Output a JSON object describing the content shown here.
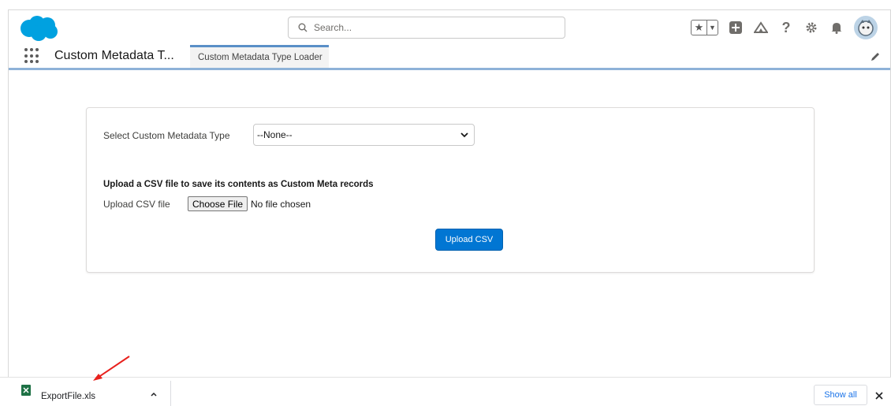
{
  "header": {
    "search_placeholder": "Search...",
    "icons": [
      "salesforce-cloud-logo",
      "star-icon",
      "chevron-down-icon",
      "plus-icon",
      "trailhead-icon",
      "help-icon",
      "gear-icon",
      "bell-icon",
      "avatar"
    ]
  },
  "nav": {
    "app_name": "Custom Metadata T...",
    "tab_label": "Custom Metadata Type Loader"
  },
  "form": {
    "select_label": "Select Custom Metadata Type",
    "select_value": "--None--",
    "upload_heading": "Upload a CSV file to save its contents as Custom Meta records",
    "upload_label": "Upload CSV file",
    "choose_file_label": "Choose File",
    "no_file_text": "No file chosen",
    "upload_button_label": "Upload CSV"
  },
  "download_bar": {
    "file_name": "ExportFile.xls",
    "show_all_label": "Show all"
  },
  "colors": {
    "brand_blue": "#0176d3",
    "logo_blue": "#00a1e0",
    "annotation_arrow": "#e8211d"
  }
}
